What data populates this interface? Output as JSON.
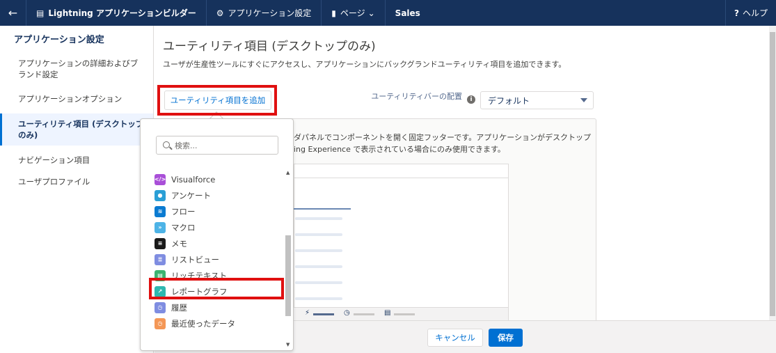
{
  "topbar": {
    "back_icon": "←",
    "builder_label": "Lightning アプリケーションビルダー",
    "settings_label": "アプリケーション設定",
    "pages_label": "ページ",
    "app_name": "Sales",
    "help_label": "ヘルプ"
  },
  "sidebar": {
    "title": "アプリケーション設定",
    "items": [
      {
        "label": "アプリケーションの詳細およびブランド設定"
      },
      {
        "label": "アプリケーションオプション"
      },
      {
        "label": "ユーティリティ項目 (デスクトップのみ)"
      },
      {
        "label": "ナビゲーション項目"
      },
      {
        "label": "ユーザプロファイル"
      }
    ]
  },
  "main": {
    "title": "ユーティリティ項目 (デスクトップのみ)",
    "description": "ユーザが生産性ツールにすぐにアクセスし、アプリケーションにバックグランドユーティリティ項目を追加できます。",
    "add_button": "ユーティリティ項目を追加",
    "bar_label": "ユーティリティバーの配置",
    "bar_select_value": "デフォルト",
    "panel_text_line1": "ダパネルでコンポーネントを開く固定フッターです。アプリケーションがデスクトップ",
    "panel_text_line2": "ing Experience で表示されている場合にのみ使用できます。"
  },
  "dropdown": {
    "search_placeholder": "検索...",
    "items": [
      {
        "label": "Visualforce",
        "icon": "visualforce-icon",
        "color": "#a94fd8"
      },
      {
        "label": "アンケート",
        "icon": "survey-icon",
        "color": "#2a9fd6"
      },
      {
        "label": "フロー",
        "icon": "flow-icon",
        "color": "#0b7bd1"
      },
      {
        "label": "マクロ",
        "icon": "macro-icon",
        "color": "#4db3e6"
      },
      {
        "label": "メモ",
        "icon": "note-icon",
        "color": "#1a1a1a"
      },
      {
        "label": "リストビュー",
        "icon": "list-view-icon",
        "color": "#7f8de1"
      },
      {
        "label": "リッチテキスト",
        "icon": "rich-text-icon",
        "color": "#3cb371"
      },
      {
        "label": "レポートグラフ",
        "icon": "report-chart-icon",
        "color": "#2eb8b0"
      },
      {
        "label": "履歴",
        "icon": "history-icon",
        "color": "#7f8de1"
      },
      {
        "label": "最近使ったデータ",
        "icon": "recent-icon",
        "color": "#f49756"
      }
    ]
  },
  "footer": {
    "cancel_label": "キャンセル",
    "save_label": "保存"
  },
  "colors": {
    "topbar": "#16325c",
    "brand": "#0070d2",
    "highlight": "#e01010"
  }
}
